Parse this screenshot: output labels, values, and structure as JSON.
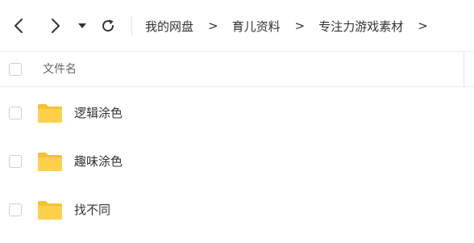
{
  "toolbar": {
    "back_icon": "chevron-left-icon",
    "forward_icon": "chevron-right-icon",
    "history_dropdown_icon": "caret-down-icon",
    "refresh_icon": "refresh-icon"
  },
  "breadcrumb": {
    "separator": ">",
    "items": [
      {
        "label": "我的网盘"
      },
      {
        "label": "育儿资料"
      },
      {
        "label": "专注力游戏素材"
      }
    ],
    "trailing_separator": ">"
  },
  "list_header": {
    "name_column": "文件名"
  },
  "files": [
    {
      "name": "逻辑涂色",
      "type": "folder"
    },
    {
      "name": "趣味涂色",
      "type": "folder"
    },
    {
      "name": "找不同",
      "type": "folder"
    }
  ],
  "colors": {
    "folder": "#FFD04A",
    "folder_back": "#F5C236",
    "border": "#ECECEC",
    "text": "#333333",
    "muted_text": "#666666"
  }
}
